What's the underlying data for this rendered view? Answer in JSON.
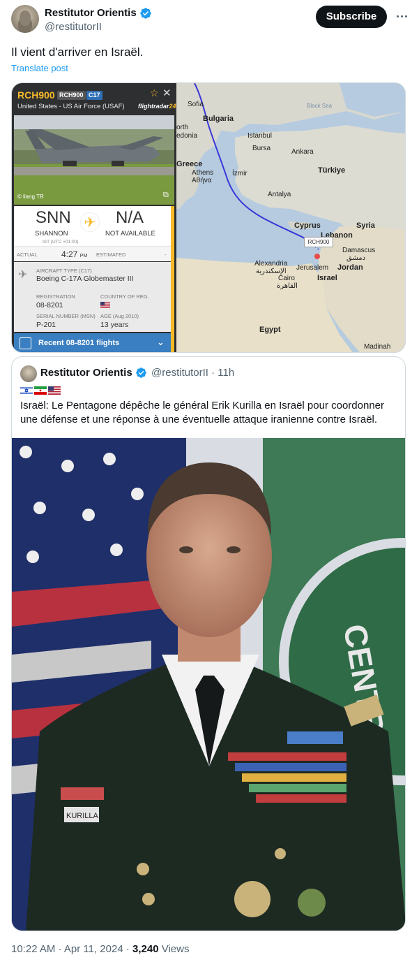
{
  "author": {
    "display_name": "Restitutor Orientis",
    "handle": "@restitutorII",
    "subscribe_label": "Subscribe"
  },
  "tweet": {
    "text": "Il vient d'arriver en Israël.",
    "translate_label": "Translate post",
    "timestamp": "10:22 AM · Apr 11, 2024 · ",
    "views_count": "3,240",
    "views_label": " Views"
  },
  "flight": {
    "callsign": "RCH900",
    "badge_reg": "RCH900",
    "badge_type": "C17",
    "operator": "United States - US Air Force (USAF)",
    "brand": "flightradar",
    "brand_num": "24",
    "photo_credit": "© liang TR",
    "origin_code": "SNN",
    "origin_city": "SHANNON",
    "origin_tz": "IST (UTC +01:00)",
    "dest_code": "N/A",
    "dest_city": "NOT AVAILABLE",
    "actual_label": "ACTUAL",
    "actual_time": "4:27",
    "actual_ampm": "PM",
    "estimated_label": "ESTIMATED",
    "estimated_value": "-",
    "aircraft_type_label": "AIRCRAFT TYPE (C17)",
    "aircraft_type": "Boeing C-17A Globemaster III",
    "registration_label": "REGISTRATION",
    "registration": "08-8201",
    "country_label": "COUNTRY OF REG.",
    "serial_label": "SERIAL NUMBER (MSN)",
    "serial": "P-201",
    "age_label": "AGE (Aug 2010)",
    "age": "13 years",
    "recent_flights": "Recent 08-8201 flights",
    "map_marker": "RCH900"
  },
  "map_labels": {
    "sofia": "Sofia",
    "bulgaria": "Bulgaria",
    "north": "orth",
    "macedonia": "edonia",
    "black_sea": "Black Sea",
    "istanbul": "Istanbul",
    "bursa": "Bursa",
    "ankara": "Ankara",
    "greece": "Greece",
    "athens": "Athens",
    "athens_gr": "Αθήνα",
    "izmir": "İzmir",
    "turkiye": "Türkiye",
    "antalya": "Antalya",
    "cyprus": "Cyprus",
    "syria": "Syria",
    "lebanon": "Lebanon",
    "damascus": "Damascus",
    "damascus_ar": "دمشق",
    "alexandria": "Alexandria",
    "alexandria_ar": "الإسكندرية",
    "jerusalem": "Jerusalem",
    "jordan": "Jordan",
    "israel": "Israel",
    "cairo": "Cairo",
    "cairo_ar": "القاهرة",
    "egypt": "Egypt",
    "madinah": "Madinah"
  },
  "quote": {
    "display_name": "Restitutor Orientis",
    "handle": "@restitutorII · 11h",
    "text": "Israël: Le Pentagone dépêche le général Erik Kurilla en Israël pour coordonner une défense et une réponse à une éventuelle attaque iranienne contre Israël.",
    "nameplate": "KURILLA",
    "patch_text": "CENTR"
  },
  "colors": {
    "accent": "#1d9bf0",
    "fr_yellow": "#f7b928",
    "fr_blue": "#3a7fc1",
    "verified": "#1d9bf0"
  }
}
